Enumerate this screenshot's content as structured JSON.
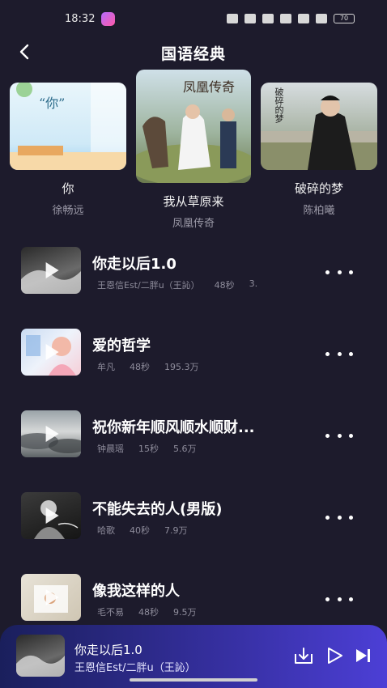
{
  "status_bar": {
    "time": "18:32",
    "battery": "70"
  },
  "header": {
    "title": "国语经典"
  },
  "albums": [
    {
      "name": "你",
      "artist": "徐畅远",
      "cover_text": "“你”"
    },
    {
      "name": "我从草原来",
      "artist": "凤凰传奇",
      "cover_text": "凤凰传奇"
    },
    {
      "name": "破碎的梦",
      "artist": "陈柏曦",
      "cover_text": "破碎的梦"
    }
  ],
  "songs": [
    {
      "title": "你走以后1.0",
      "artist": "王恩信Est/二胖u（王訫）",
      "duration": "48秒",
      "plays": "3."
    },
    {
      "title": "爱的哲学",
      "artist": "牟凡",
      "duration": "48秒",
      "plays": "195.3万"
    },
    {
      "title": "祝你新年顺风顺水顺财...",
      "artist": "钟晨瑶",
      "duration": "15秒",
      "plays": "5.6万"
    },
    {
      "title": "不能失去的人(男版)",
      "artist": "哈歌",
      "duration": "40秒",
      "plays": "7.9万"
    },
    {
      "title": "像我这样的人",
      "artist": "毛不易",
      "duration": "48秒",
      "plays": "9.5万"
    }
  ],
  "player": {
    "title": "你走以后1.0",
    "artist": "王恩信Est/二胖u（王訫）"
  },
  "icons": {
    "back": "chevron-left-icon",
    "more": "more-horizontal-icon",
    "play": "play-icon",
    "download": "download-icon",
    "next": "skip-next-icon"
  },
  "colors": {
    "background": "#1d1b2c",
    "player_start": "#1a1f5c",
    "player_end": "#4c3fd6",
    "meta_text": "#8e8c9b"
  }
}
